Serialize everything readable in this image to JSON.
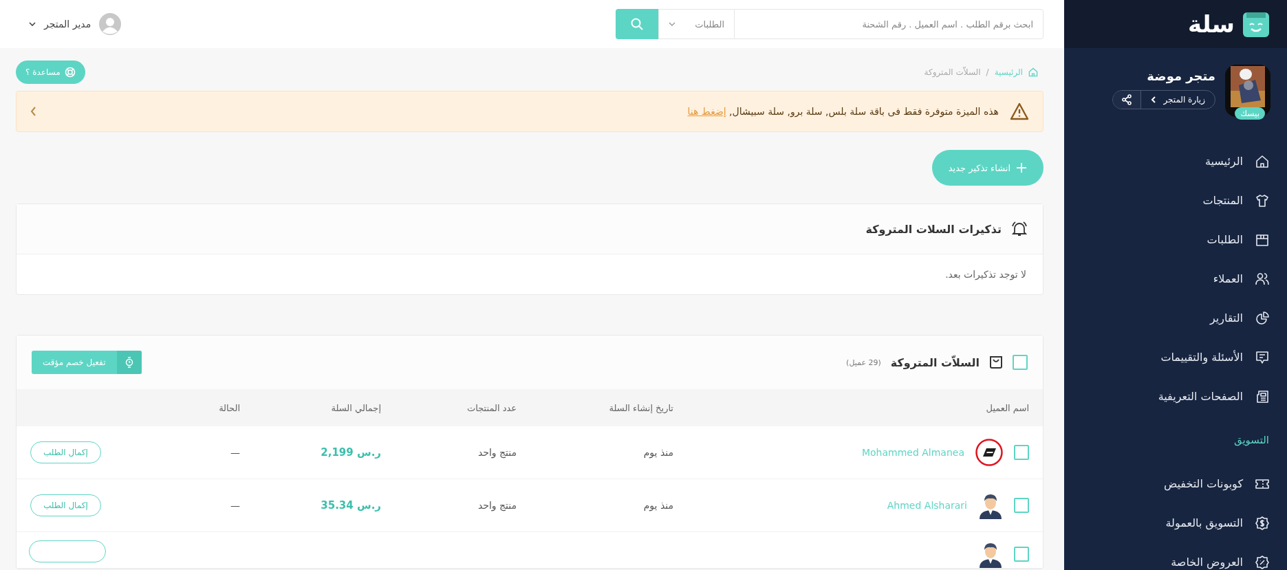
{
  "topbar": {
    "user": {
      "name": "مدير المتجر"
    },
    "search": {
      "placeholder": "ابحث برقم الطلب . اسم العميل . رقم الشحنة",
      "scope": "الطلبات"
    }
  },
  "sidebar": {
    "logo": "سلة",
    "store": {
      "name": "متجر موضة",
      "plan": "بيسك",
      "visit": "زيارة المتجر"
    },
    "items": [
      {
        "kind": "link",
        "label": "الرئيسية"
      },
      {
        "kind": "link",
        "label": "المنتجات"
      },
      {
        "kind": "link",
        "label": "الطلبات"
      },
      {
        "kind": "link",
        "label": "العملاء"
      },
      {
        "kind": "link",
        "label": "التقارير"
      },
      {
        "kind": "link",
        "label": "الأسئلة والتقييمات"
      },
      {
        "kind": "link",
        "label": "الصفحات التعريفية"
      },
      {
        "kind": "heading",
        "label": "التسويق"
      },
      {
        "kind": "link",
        "label": "كوبونات التخفيض"
      },
      {
        "kind": "link",
        "label": "التسويق بالعمولة"
      },
      {
        "kind": "link",
        "label": "العروض الخاصة"
      }
    ]
  },
  "breadcrumb": {
    "separator": "/",
    "items": [
      {
        "kind": "link",
        "label": "الرئيسية"
      },
      {
        "kind": "current",
        "label": "السلاّت المتروكة"
      }
    ]
  },
  "help_button": "مساعدة ؟",
  "alert": {
    "text": "هذه الميزة متوفرة فقط فى باقة سلة بلس, سلة برو, سلة سبيشال,",
    "link": "إضغط هنا"
  },
  "new_button": "انشاء تذكير جديد",
  "reminders": {
    "title": "تذكيرات السلات المتروكة",
    "empty": "لا توجد تذكيرات بعد."
  },
  "carts": {
    "title": "السلاّت المتروكة",
    "count": "(29 عميل)",
    "checked": false,
    "discount_button": "تفعيل خصم مؤقت",
    "columns": [
      "اسم العميل",
      "تاريخ إنشاء السلة",
      "عدد المنتجات",
      "إجمالي السلة",
      "الحالة"
    ],
    "rows": [
      {
        "kind": "full",
        "checked": false,
        "name": "Mohammed Almanea",
        "created": "منذ يوم",
        "count": "منتج واحد",
        "total": "2,199 ر.س",
        "status": "—",
        "action": "إكمال الطلب"
      },
      {
        "kind": "full",
        "checked": false,
        "name": "Ahmed Alsharari",
        "created": "منذ يوم",
        "count": "منتج واحد",
        "total": "35.34 ر.س",
        "status": "—",
        "action": "إكمال الطلب"
      },
      {
        "kind": "partial",
        "checked": false
      }
    ]
  }
}
